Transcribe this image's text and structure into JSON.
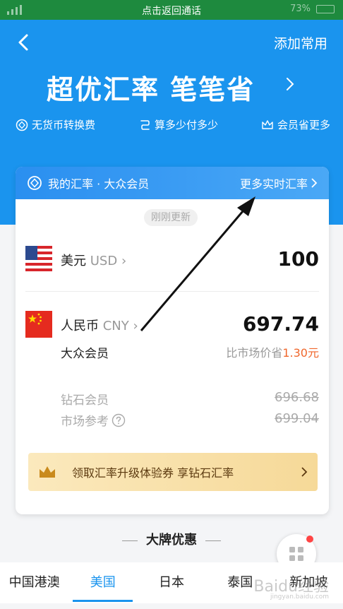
{
  "status_bar": {
    "call_banner": "点击返回通话",
    "battery": "73%"
  },
  "header": {
    "back_icon": "chevron-left-icon",
    "add_favorite": "添加常用",
    "headline": "超优汇率 笔笔省",
    "features": [
      {
        "icon": "coin-circle-icon",
        "label": "无货币转换费"
      },
      {
        "icon": "calculator-icon",
        "label": "算多少付多少"
      },
      {
        "icon": "crown-outline-icon",
        "label": "会员省更多"
      }
    ]
  },
  "rate_card": {
    "title": "我的汇率 · 大众会员",
    "more_rates": "更多实时汇率",
    "updated_badge": "刚刚更新",
    "from": {
      "name": "美元",
      "code": "USD",
      "amount": "100",
      "flag": "us-flag-icon"
    },
    "to": {
      "name": "人民币",
      "code": "CNY",
      "amount": "697.74",
      "flag": "cn-flag-icon"
    },
    "member_label": "大众会员",
    "saving_prefix": "比市场价省",
    "saving_amount": "1.30元",
    "diamond": {
      "label": "钻石会员",
      "value": "696.68"
    },
    "market": {
      "label": "市场参考",
      "value": "699.04"
    },
    "promo": "领取汇率升级体验券 享钻石汇率"
  },
  "brands": {
    "title": "大牌优惠"
  },
  "tabs": [
    {
      "label": "中国港澳",
      "active": false
    },
    {
      "label": "美国",
      "active": true
    },
    {
      "label": "日本",
      "active": false
    },
    {
      "label": "泰国",
      "active": false
    },
    {
      "label": "新加坡",
      "active": false
    }
  ],
  "watermark": {
    "text": "Baidu经验",
    "url": "jingyan.baidu.com"
  },
  "colors": {
    "brand_blue": "#1a94ee",
    "status_green": "#1e8a3e",
    "saving_orange": "#f0672c"
  }
}
